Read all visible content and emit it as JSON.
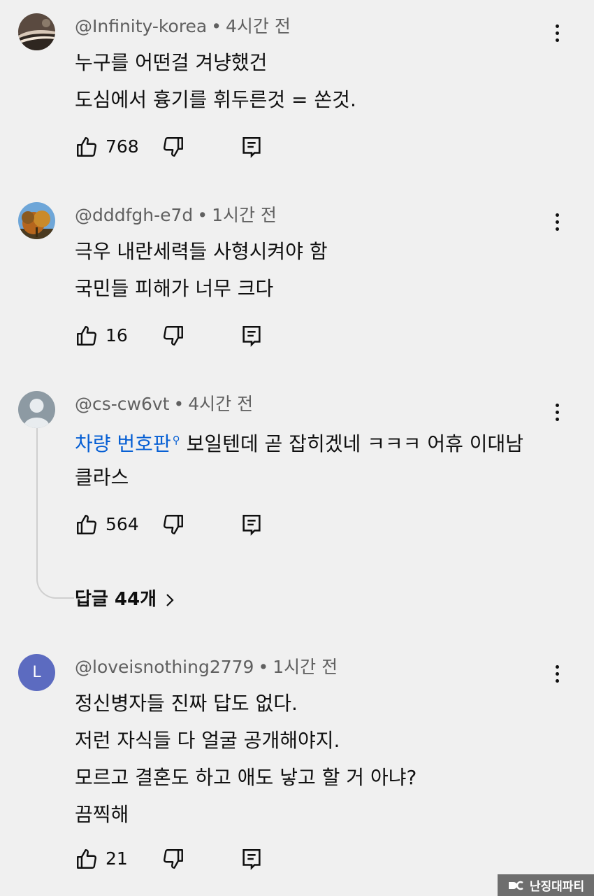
{
  "comments": [
    {
      "handle": "@Infinity-korea",
      "time": "4시간 전",
      "lines": [
        "누구를 어떤걸 겨냥했건",
        "도심에서 흉기를 휘두른것 = 쏜것."
      ],
      "likes": "768",
      "avatar_icon": "landscape-avatar"
    },
    {
      "handle": "@dddfgh-e7d",
      "time": "1시간 전",
      "lines": [
        "극우 내란세력들 사형시켜야  함",
        "국민들 피해가 너무 크다"
      ],
      "likes": "16",
      "avatar_icon": "autumn-tree-avatar"
    },
    {
      "handle": "@cs-cw6vt",
      "time": "4시간 전",
      "link_text": "차량 번호판",
      "link_icon": "search-icon",
      "line1_rest": " 보일텐데 곧 잡히겠네 ㅋㅋㅋ 어휴 이대남",
      "line2": "클라스",
      "likes": "564",
      "avatar_icon": "default-user-avatar",
      "replies_label": "답글 44개"
    },
    {
      "handle": "@loveisnothing2779",
      "time": "1시간 전",
      "lines": [
        "정신병자들 진짜 답도 없다.",
        "저런 자식들 다 얼굴 공개해야지.",
        "모르고 결혼도 하고 애도 낳고 할 거 아냐?",
        "끔찍해"
      ],
      "likes": "21",
      "avatar_letter": "L",
      "avatar_color": "#5c6bc0"
    }
  ],
  "separator": "•",
  "watermark": "난징대파티",
  "colors": {
    "background": "#f0f0f0",
    "meta_text": "#606060",
    "link": "#065fd4"
  }
}
